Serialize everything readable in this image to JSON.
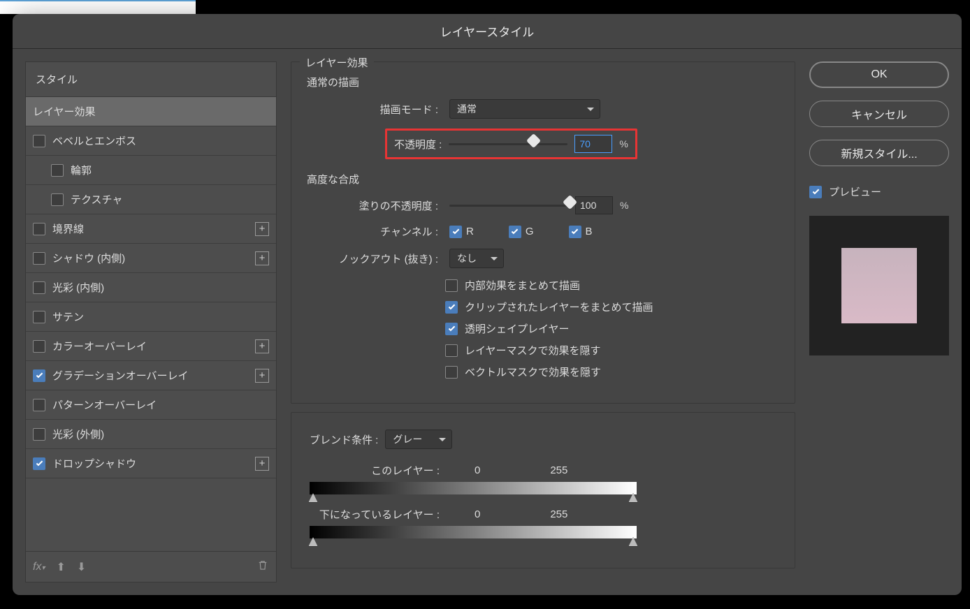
{
  "dialog": {
    "title": "レイヤースタイル"
  },
  "left": {
    "header": "スタイル",
    "items": [
      {
        "label": "レイヤー効果",
        "checked": null,
        "child": false,
        "plus": false,
        "selected": true
      },
      {
        "label": "ベベルとエンボス",
        "checked": false,
        "child": false,
        "plus": false
      },
      {
        "label": "輪郭",
        "checked": false,
        "child": true,
        "plus": false
      },
      {
        "label": "テクスチャ",
        "checked": false,
        "child": true,
        "plus": false
      },
      {
        "label": "境界線",
        "checked": false,
        "child": false,
        "plus": true
      },
      {
        "label": "シャドウ (内側)",
        "checked": false,
        "child": false,
        "plus": true
      },
      {
        "label": "光彩 (内側)",
        "checked": false,
        "child": false,
        "plus": false
      },
      {
        "label": "サテン",
        "checked": false,
        "child": false,
        "plus": false
      },
      {
        "label": "カラーオーバーレイ",
        "checked": false,
        "child": false,
        "plus": true
      },
      {
        "label": "グラデーションオーバーレイ",
        "checked": true,
        "child": false,
        "plus": true
      },
      {
        "label": "パターンオーバーレイ",
        "checked": false,
        "child": false,
        "plus": false
      },
      {
        "label": "光彩 (外側)",
        "checked": false,
        "child": false,
        "plus": false
      },
      {
        "label": "ドロップシャドウ",
        "checked": true,
        "child": false,
        "plus": true
      }
    ],
    "footer": {
      "fx": "fx",
      "up": "▲",
      "down": "▼",
      "trash": "🗑"
    }
  },
  "center": {
    "effects_title": "レイヤー効果",
    "normal_title": "通常の描画",
    "blend_mode_label": "描画モード :",
    "blend_mode_value": "通常",
    "opacity_label": "不透明度 :",
    "opacity_value": "70",
    "percent": "%",
    "adv_title": "高度な合成",
    "fill_opacity_label": "塗りの不透明度 :",
    "fill_opacity_value": "100",
    "channels_label": "チャンネル :",
    "ch_r": "R",
    "ch_g": "G",
    "ch_b": "B",
    "knockout_label": "ノックアウト (抜き) :",
    "knockout_value": "なし",
    "adv_checks": [
      {
        "label": "内部効果をまとめて描画",
        "checked": false
      },
      {
        "label": "クリップされたレイヤーをまとめて描画",
        "checked": true
      },
      {
        "label": "透明シェイプレイヤー",
        "checked": true
      },
      {
        "label": "レイヤーマスクで効果を隠す",
        "checked": false
      },
      {
        "label": "ベクトルマスクで効果を隠す",
        "checked": false
      }
    ],
    "blendif_label": "ブレンド条件 :",
    "blendif_value": "グレー",
    "this_layer_label": "このレイヤー :",
    "this_low": "0",
    "this_high": "255",
    "under_layer_label": "下になっているレイヤー :",
    "under_low": "0",
    "under_high": "255"
  },
  "right": {
    "ok": "OK",
    "cancel": "キャンセル",
    "new_style": "新規スタイル...",
    "preview": "プレビュー"
  }
}
